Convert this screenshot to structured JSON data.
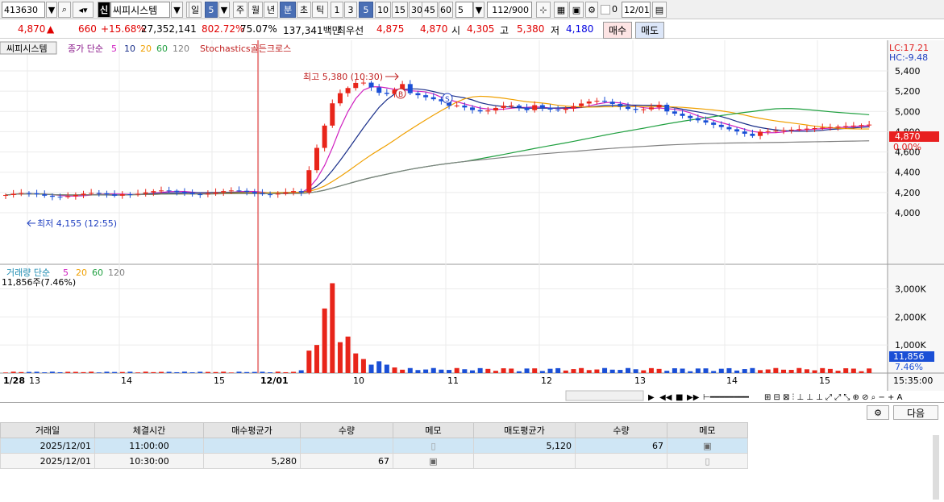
{
  "toolbar": {
    "code": "413630",
    "badge": "신",
    "stock_name": "씨피시스템",
    "alert": "!",
    "period_day": "일",
    "period_num": "5",
    "tabs": [
      "주",
      "월",
      "년",
      "분",
      "초",
      "틱"
    ],
    "interval_buttons": [
      "1",
      "3",
      "5",
      "10",
      "15",
      "30",
      "45",
      "60"
    ],
    "interval_input": "5",
    "count_display": "112/900",
    "zero_label": "0",
    "date_value": "12/01"
  },
  "quote": {
    "price": "4,870",
    "arrow": "▲",
    "change": "660",
    "change_pct": "+15.68%",
    "volume": "27,352,141",
    "vol_ratio": "802.72%",
    "turnover": "75.07%",
    "amount": "137,341백만",
    "best_label": "최우선",
    "best_ask": "4,875",
    "best_bid": "4,870",
    "open_label": "시",
    "open": "4,305",
    "high_label": "고",
    "high": "5,380",
    "low_label": "저",
    "low": "4,180",
    "buy_label": "매수",
    "sell_label": "매도"
  },
  "chart_labels": {
    "stock_tab": "씨피시스템",
    "ma_title": "종가 단순",
    "ma_periods": [
      "5",
      "10",
      "20",
      "60",
      "120"
    ],
    "stochastic_label": "Stochastics골든크로스",
    "lc": "LC:17.21",
    "hc": "HC:-9.48",
    "high_annotation": "최고 5,380 (10:30)",
    "low_annotation": "최저 4,155 (12:55)",
    "price_tag": "4,870",
    "price_pct": "0.00%",
    "vol_title": "거래량 단순",
    "vol_periods": [
      "5",
      "20",
      "60",
      "120"
    ],
    "vol_value": "11,856주(7.46%)",
    "vol_tag": "11,856",
    "vol_pct": "7.46%",
    "time_display": "15:35:00",
    "marker_b": "B",
    "marker_s": "S"
  },
  "chart_data": {
    "type": "candlestick",
    "price_axis_ticks": [
      "5,400",
      "5,200",
      "5,000",
      "4,800",
      "4,600",
      "4,400",
      "4,200",
      "4,000"
    ],
    "volume_axis_ticks": [
      "3,000K",
      "2,000K",
      "1,000K"
    ],
    "x_tick_labels": [
      "1/28",
      "13",
      "14",
      "15",
      "12/01",
      "10",
      "11",
      "12",
      "13",
      "14",
      "15"
    ],
    "colors": {
      "up": "#e8251a",
      "down": "#1a4fd6",
      "ma5": "#d020c0",
      "ma10": "#1a2f8a",
      "ma20": "#f0a000",
      "ma60": "#20a040",
      "ma120": "#808080"
    }
  },
  "trade_table": {
    "headers": [
      "거래일",
      "체결시간",
      "매수평균가",
      "수량",
      "메모",
      "매도평균가",
      "수량",
      "메모"
    ],
    "rows": [
      [
        "2025/12/01",
        "11:00:00",
        "",
        "",
        "",
        "5,120",
        "67",
        ""
      ],
      [
        "2025/12/01",
        "10:30:00",
        "5,280",
        "67",
        "",
        "",
        "",
        ""
      ]
    ],
    "next_button": "다음"
  }
}
